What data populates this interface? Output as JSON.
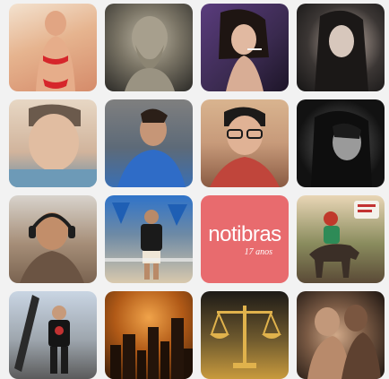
{
  "tiles": [
    {
      "name": "avatar-tile-1",
      "kind": "photo",
      "subject": "woman in red bikini"
    },
    {
      "name": "avatar-tile-2",
      "kind": "photo",
      "subject": "marble bust"
    },
    {
      "name": "avatar-tile-3",
      "kind": "photo",
      "subject": "woman with cigarette"
    },
    {
      "name": "avatar-tile-4",
      "kind": "photo",
      "subject": "dark-haired woman portrait"
    },
    {
      "name": "avatar-tile-5",
      "kind": "photo",
      "subject": "man selfie"
    },
    {
      "name": "avatar-tile-6",
      "kind": "photo",
      "subject": "bearded man in blue shirt"
    },
    {
      "name": "avatar-tile-7",
      "kind": "photo",
      "subject": "man with glasses"
    },
    {
      "name": "avatar-tile-8",
      "kind": "photo",
      "subject": "black and white portrait"
    },
    {
      "name": "avatar-tile-9",
      "kind": "photo",
      "subject": "man with headset"
    },
    {
      "name": "avatar-tile-10",
      "kind": "photo",
      "subject": "man standing by umbrellas"
    },
    {
      "name": "avatar-tile-11",
      "kind": "logo",
      "title": "notibras",
      "subtitle": "17 anos"
    },
    {
      "name": "avatar-tile-12",
      "kind": "photo",
      "subject": "rider on mule"
    },
    {
      "name": "avatar-tile-13",
      "kind": "photo",
      "subject": "man with skateboard"
    },
    {
      "name": "avatar-tile-14",
      "kind": "photo",
      "subject": "orange city skyline"
    },
    {
      "name": "avatar-tile-15",
      "kind": "photo",
      "subject": "scales of justice"
    },
    {
      "name": "avatar-tile-16",
      "kind": "photo",
      "subject": "sculpture of two figures"
    }
  ],
  "colors": {
    "background": "#f2f2f2",
    "notibras_tile": "#e86b6e"
  }
}
